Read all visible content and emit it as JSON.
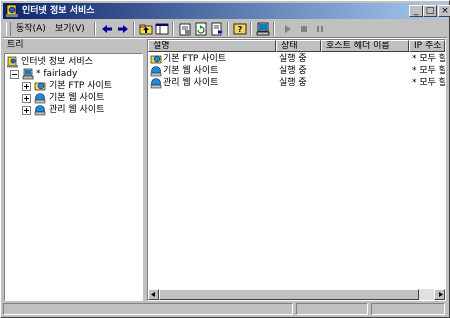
{
  "window": {
    "title": "인터넷 정보 서비스"
  },
  "menubar": {
    "action": "동작(A)",
    "view": "보기(V)"
  },
  "toolbar": {
    "icons": [
      "back-icon",
      "forward-icon",
      "up-folder-icon",
      "show-hide-tree-icon",
      "properties-icon",
      "refresh-icon",
      "export-list-icon",
      "help-icon",
      "computer-icon",
      "start-icon",
      "stop-icon",
      "pause-icon"
    ]
  },
  "tree": {
    "header": "트리",
    "root": "인터넷 정보 서비스",
    "server": "* fairlady",
    "children": [
      "기본 FTP 사이트",
      "기본 웹 사이트",
      "관리 웹 사이트"
    ]
  },
  "list": {
    "columns": [
      "설명",
      "상태",
      "호스트 헤더 이름",
      "IP 주소"
    ],
    "rows": [
      {
        "desc": "기본 FTP 사이트",
        "status": "실행 중",
        "host": "",
        "ip": "* 모두 할"
      },
      {
        "desc": "기본 웹 사이트",
        "status": "실행 중",
        "host": "",
        "ip": "* 모두 할"
      },
      {
        "desc": "관리 웹 사이트",
        "status": "실행 중",
        "host": "",
        "ip": "* 모두 할"
      }
    ]
  }
}
